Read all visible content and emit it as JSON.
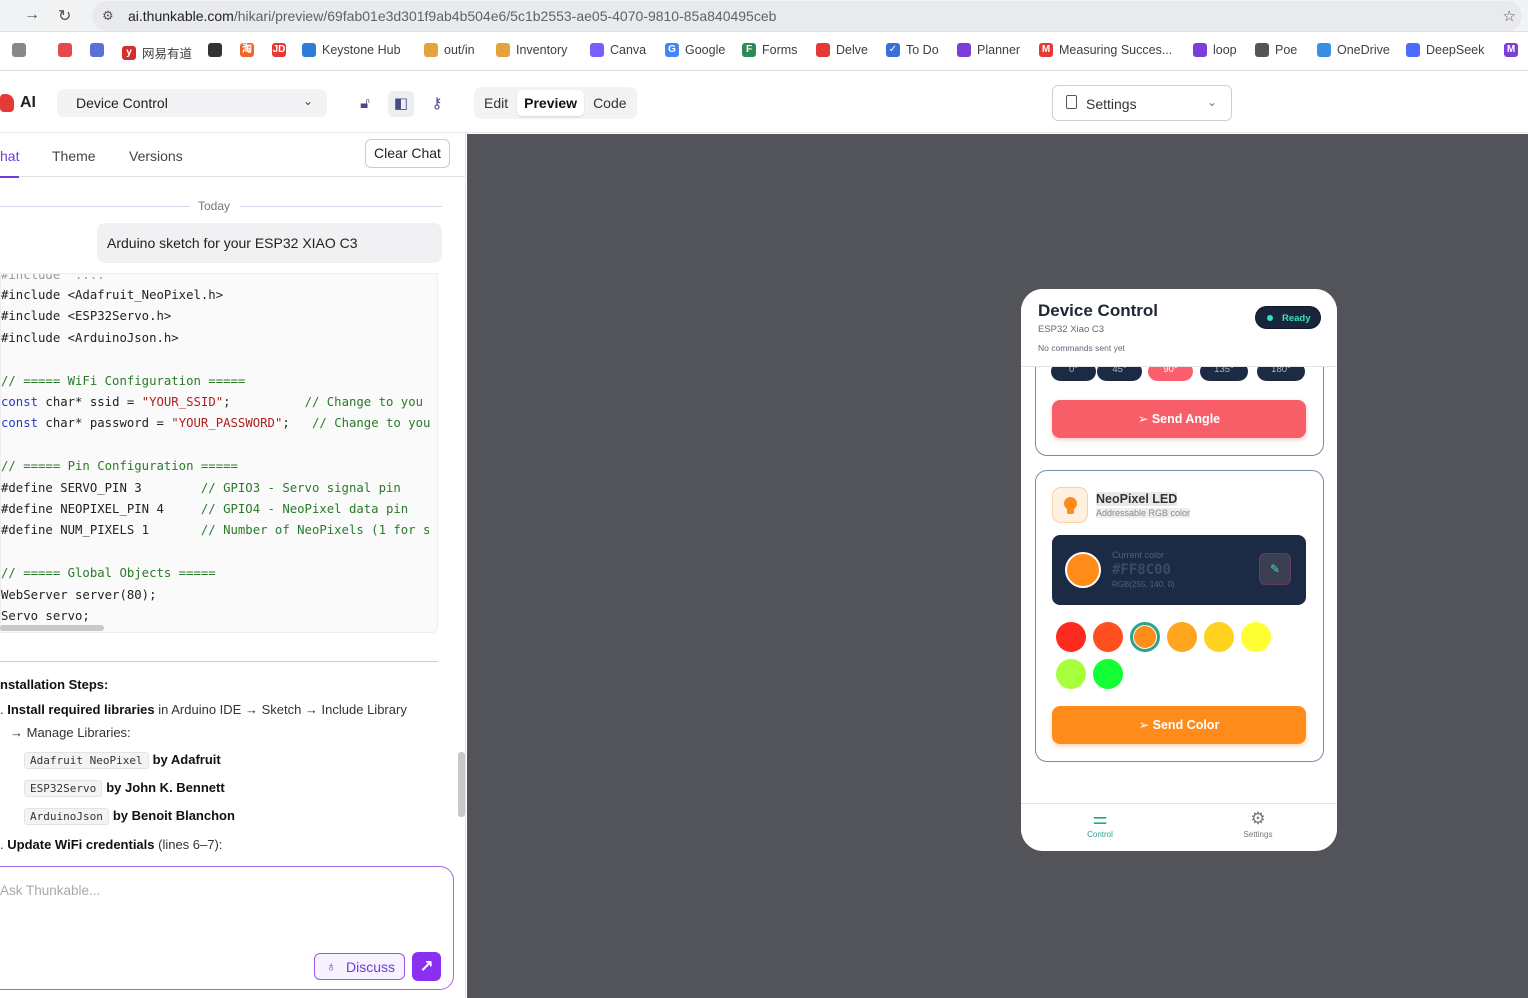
{
  "browser": {
    "url_host": "ai.thunkable.com",
    "url_path": "/hikari/preview/69fab01e3d301f9ab4b504e6/5c1b2553-ae05-4070-9810-85a840495ceb",
    "bookmarks": [
      {
        "label": "",
        "color": "#888"
      },
      {
        "label": "",
        "color": "#e5484d"
      },
      {
        "label": "",
        "color": "#5b6fd8"
      },
      {
        "label": "网易有道",
        "color": "#d32f2f",
        "glyph": "y"
      },
      {
        "label": "",
        "color": "#333"
      },
      {
        "label": "",
        "color": "#f0642d",
        "glyph": "淘"
      },
      {
        "label": "",
        "color": "#e53935",
        "glyph": "JD"
      },
      {
        "label": "Keystone Hub",
        "color": "#2e7dd6"
      },
      {
        "label": "out/in",
        "color": "#e6a23c"
      },
      {
        "label": "Inventory",
        "color": "#e6a23c"
      },
      {
        "label": "Canva",
        "color": "#7b5cff"
      },
      {
        "label": "Google",
        "color": "#4285f4",
        "glyph": "G"
      },
      {
        "label": "Forms",
        "color": "#2e8b57",
        "glyph": "F"
      },
      {
        "label": "Delve",
        "color": "#e53935"
      },
      {
        "label": "To Do",
        "color": "#3a6fd8",
        "glyph": "✓"
      },
      {
        "label": "Planner",
        "color": "#7b3fd8"
      },
      {
        "label": "Measuring Succes...",
        "color": "#e53935",
        "glyph": "M"
      },
      {
        "label": "loop",
        "color": "#7b3fd8"
      },
      {
        "label": "Poe",
        "color": "#555"
      },
      {
        "label": "OneDrive",
        "color": "#3a8ee6"
      },
      {
        "label": "DeepSeek",
        "color": "#4d6bfe"
      },
      {
        "label": "",
        "color": "#7b3fd8",
        "glyph": "M"
      }
    ]
  },
  "topbar": {
    "logo_text": "AI",
    "project_name": "Device Control",
    "mode_tabs": [
      "Edit",
      "Preview",
      "Code"
    ],
    "active_mode": "Preview",
    "settings_label": "Settings"
  },
  "sidebar": {
    "tabs": [
      "hat",
      "Theme",
      "Versions"
    ],
    "clear_chat": "Clear Chat",
    "today": "Today",
    "user_message": "Arduino sketch for your ESP32 XIAO C3"
  },
  "code_lines": [
    {
      "t": "#include <Adafruit_NeoPixel.h>"
    },
    {
      "t": "#include <ESP32Servo.h>"
    },
    {
      "t": "#include <ArduinoJson.h>"
    },
    {
      "t": ""
    },
    {
      "t": "// ===== WiFi Configuration =====",
      "c": "cm"
    },
    {
      "kw": "const",
      "t": " char* ssid = ",
      "str": "\"YOUR_SSID\"",
      "tail": ";          ",
      "cm": "// Change to you"
    },
    {
      "kw": "const",
      "t": " char* password = ",
      "str": "\"YOUR_PASSWORD\"",
      "tail": ";   ",
      "cm": "// Change to you"
    },
    {
      "t": ""
    },
    {
      "t": "// ===== Pin Configuration =====",
      "c": "cm"
    },
    {
      "t": "#define SERVO_PIN 3        ",
      "cm": "// GPIO3 - Servo signal pin"
    },
    {
      "t": "#define NEOPIXEL_PIN 4     ",
      "cm": "// GPIO4 - NeoPixel data pin"
    },
    {
      "t": "#define NUM_PIXELS 1       ",
      "cm": "// Number of NeoPixels (1 for s"
    },
    {
      "t": ""
    },
    {
      "t": "// ===== Global Objects =====",
      "c": "cm"
    },
    {
      "t": "WebServer server(80);"
    },
    {
      "t": "Servo servo;"
    }
  ],
  "install": {
    "heading": "nstallation Steps:",
    "step1_num": ".",
    "step1_bold": "Install required libraries",
    "step1_rest": " in Arduino IDE → Sketch → Include Library",
    "step1_cont": "→ Manage Libraries:",
    "libs": [
      {
        "name": "Adafruit NeoPixel",
        "by": "by Adafruit"
      },
      {
        "name": "ESP32Servo",
        "by": "by John K. Bennett"
      },
      {
        "name": "ArduinoJson",
        "by": "by Benoit Blanchon"
      }
    ],
    "step2_bold": "Update WiFi credentials",
    "step2_rest": " (lines 6–7):"
  },
  "chat_input": {
    "placeholder": "Ask Thunkable...",
    "discuss": "Discuss"
  },
  "phone": {
    "title": "Device Control",
    "subtitle": "ESP32 Xiao C3",
    "status": "No commands sent yet",
    "badge": "Ready",
    "angles": [
      "0°",
      "45°",
      "90°",
      "135°",
      "180°"
    ],
    "selected_angle": "90°",
    "send_angle": "Send Angle",
    "led_title": "NeoPixel LED",
    "led_sub": "Addressable RGB color",
    "current_label": "Current color",
    "current_hex": "#FF8C00",
    "current_rgb": "RGB(255, 140, 0)",
    "palette": [
      "#ff2a1f",
      "#ff4f1f",
      "#ff8c1a",
      "#ffa51f",
      "#ffd21f",
      "#ffff33",
      "#a6ff3a",
      "#11ff33"
    ],
    "selected_color": "#ff8c1a",
    "send_color": "Send Color",
    "nav": [
      {
        "label": "Control",
        "icon": "sliders-icon"
      },
      {
        "label": "Settings",
        "icon": "gear-icon"
      }
    ],
    "active_nav": "Control",
    "accent": "#2aa48e"
  }
}
